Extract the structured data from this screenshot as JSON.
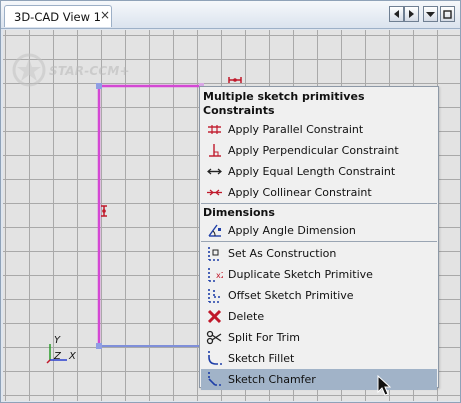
{
  "tab": {
    "title": "3D-CAD View 1",
    "close_glyph": "×"
  },
  "nav_buttons": [
    {
      "name": "scroll-left-button",
      "icon": "triangle-left-icon"
    },
    {
      "name": "scroll-right-button",
      "icon": "triangle-right-icon"
    },
    {
      "name": "dropdown-button",
      "icon": "triangle-down-icon"
    },
    {
      "name": "maximize-button",
      "icon": "square-icon"
    }
  ],
  "logo": {
    "text": "STAR-CCM+"
  },
  "axes": {
    "y": "Y",
    "z": "Z",
    "x": "X"
  },
  "menu": {
    "title": "Multiple sketch primitives",
    "sections": {
      "constraints": "Constraints",
      "dimensions": "Dimensions"
    },
    "items": {
      "parallel": "Apply Parallel Constraint",
      "perpendicular": "Apply Perpendicular Constraint",
      "equal_length": "Apply Equal Length Constraint",
      "collinear": "Apply Collinear Constraint",
      "angle": "Apply Angle Dimension",
      "construction": "Set As Construction",
      "duplicate": "Duplicate Sketch Primitive",
      "offset": "Offset Sketch Primitive",
      "delete": "Delete",
      "split": "Split For Trim",
      "fillet": "Sketch Fillet",
      "chamfer": "Sketch Chamfer"
    },
    "selected_item": "Sketch Chamfer"
  },
  "colors": {
    "sketch_selected": "#d447d4",
    "sketch_line": "#7f8fd9",
    "constraint_marker": "#c0182a",
    "menu_highlight": "#a1b3c8"
  }
}
